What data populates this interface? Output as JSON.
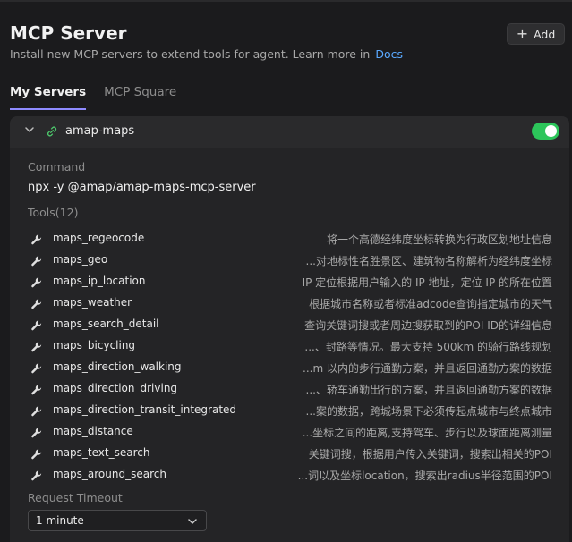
{
  "header": {
    "title": "MCP Server",
    "subtitle": "Install new MCP servers to extend tools for agent. Learn more in",
    "docs_link": "Docs",
    "add_label": "Add"
  },
  "tabs": [
    {
      "label": "My Servers",
      "active": true
    },
    {
      "label": "MCP Square",
      "active": false
    }
  ],
  "server": {
    "name": "amap-maps",
    "enabled": true,
    "command_label": "Command",
    "command": "npx -y @amap/amap-maps-mcp-server",
    "tools_label": "Tools(12)",
    "tools": [
      {
        "name": "maps_regeocode",
        "desc": "将一个高德经纬度坐标转换为行政区划地址信息"
      },
      {
        "name": "maps_geo",
        "desc": "...对地标性名胜景区、建筑物名称解析为经纬度坐标"
      },
      {
        "name": "maps_ip_location",
        "desc": "IP 定位根据用户输入的 IP 地址，定位 IP 的所在位置"
      },
      {
        "name": "maps_weather",
        "desc": "根据城市名称或者标准adcode查询指定城市的天气"
      },
      {
        "name": "maps_search_detail",
        "desc": "查询关键词搜或者周边搜获取到的POI ID的详细信息"
      },
      {
        "name": "maps_bicycling",
        "desc": "...、封路等情况。最大支持 500km 的骑行路线规划"
      },
      {
        "name": "maps_direction_walking",
        "desc": "...m 以内的步行通勤方案，并且返回通勤方案的数据"
      },
      {
        "name": "maps_direction_driving",
        "desc": "...、轿车通勤出行的方案，并且返回通勤方案的数据"
      },
      {
        "name": "maps_direction_transit_integrated",
        "desc": "...案的数据，跨城场景下必须传起点城市与终点城市"
      },
      {
        "name": "maps_distance",
        "desc": "...坐标之间的距离,支持驾车、步行以及球面距离测量"
      },
      {
        "name": "maps_text_search",
        "desc": "关键词搜，根据用户传入关键词，搜索出相关的POI"
      },
      {
        "name": "maps_around_search",
        "desc": "...词以及坐标location，搜索出radius半径范围的POI"
      }
    ],
    "timeout_label": "Request Timeout",
    "timeout_value": "1 minute"
  },
  "colors": {
    "background": "#1b1b1d",
    "card": "#242426",
    "accent_tab": "#8f8bff",
    "link": "#5aa9ff",
    "toggle_on": "#2cc55a",
    "server_link_icon": "#4cc36a"
  },
  "icons": {
    "add": "plus-icon",
    "expand": "chevron-down-icon",
    "server": "link-icon",
    "tool": "wrench-icon",
    "select": "chevron-down-icon"
  }
}
